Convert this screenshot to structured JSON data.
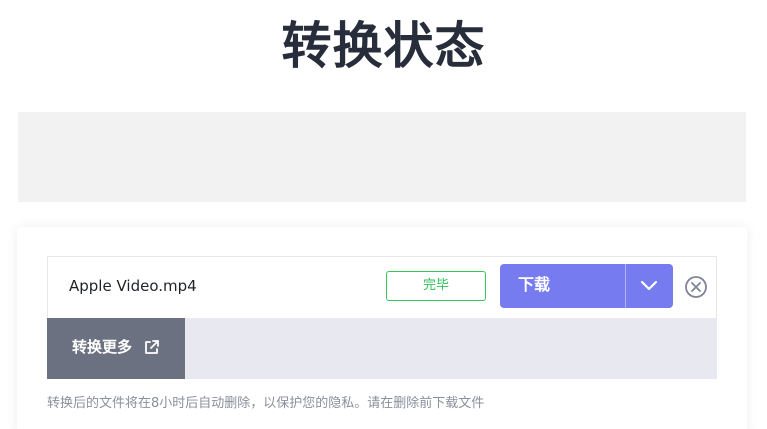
{
  "page": {
    "title": "转换状态"
  },
  "file": {
    "name": "Apple Video.mp4",
    "status": "完毕",
    "download_label": "下载"
  },
  "actions": {
    "convert_more_label": "转换更多"
  },
  "notice": "转换后的文件将在8小时后自动删除，以保护您的隐私。请在删除前下载文件",
  "colors": {
    "title": "#272d3a",
    "status_green": "#34c759",
    "download_bg": "#767cf0",
    "more_btn_bg": "#6b7180",
    "bottom_bar_bg": "#e8e9f0",
    "ad_bg": "#f2f2f2"
  },
  "icons": {
    "dropdown": "chevron-down-icon",
    "remove": "close-circle-icon",
    "external": "external-link-icon"
  }
}
